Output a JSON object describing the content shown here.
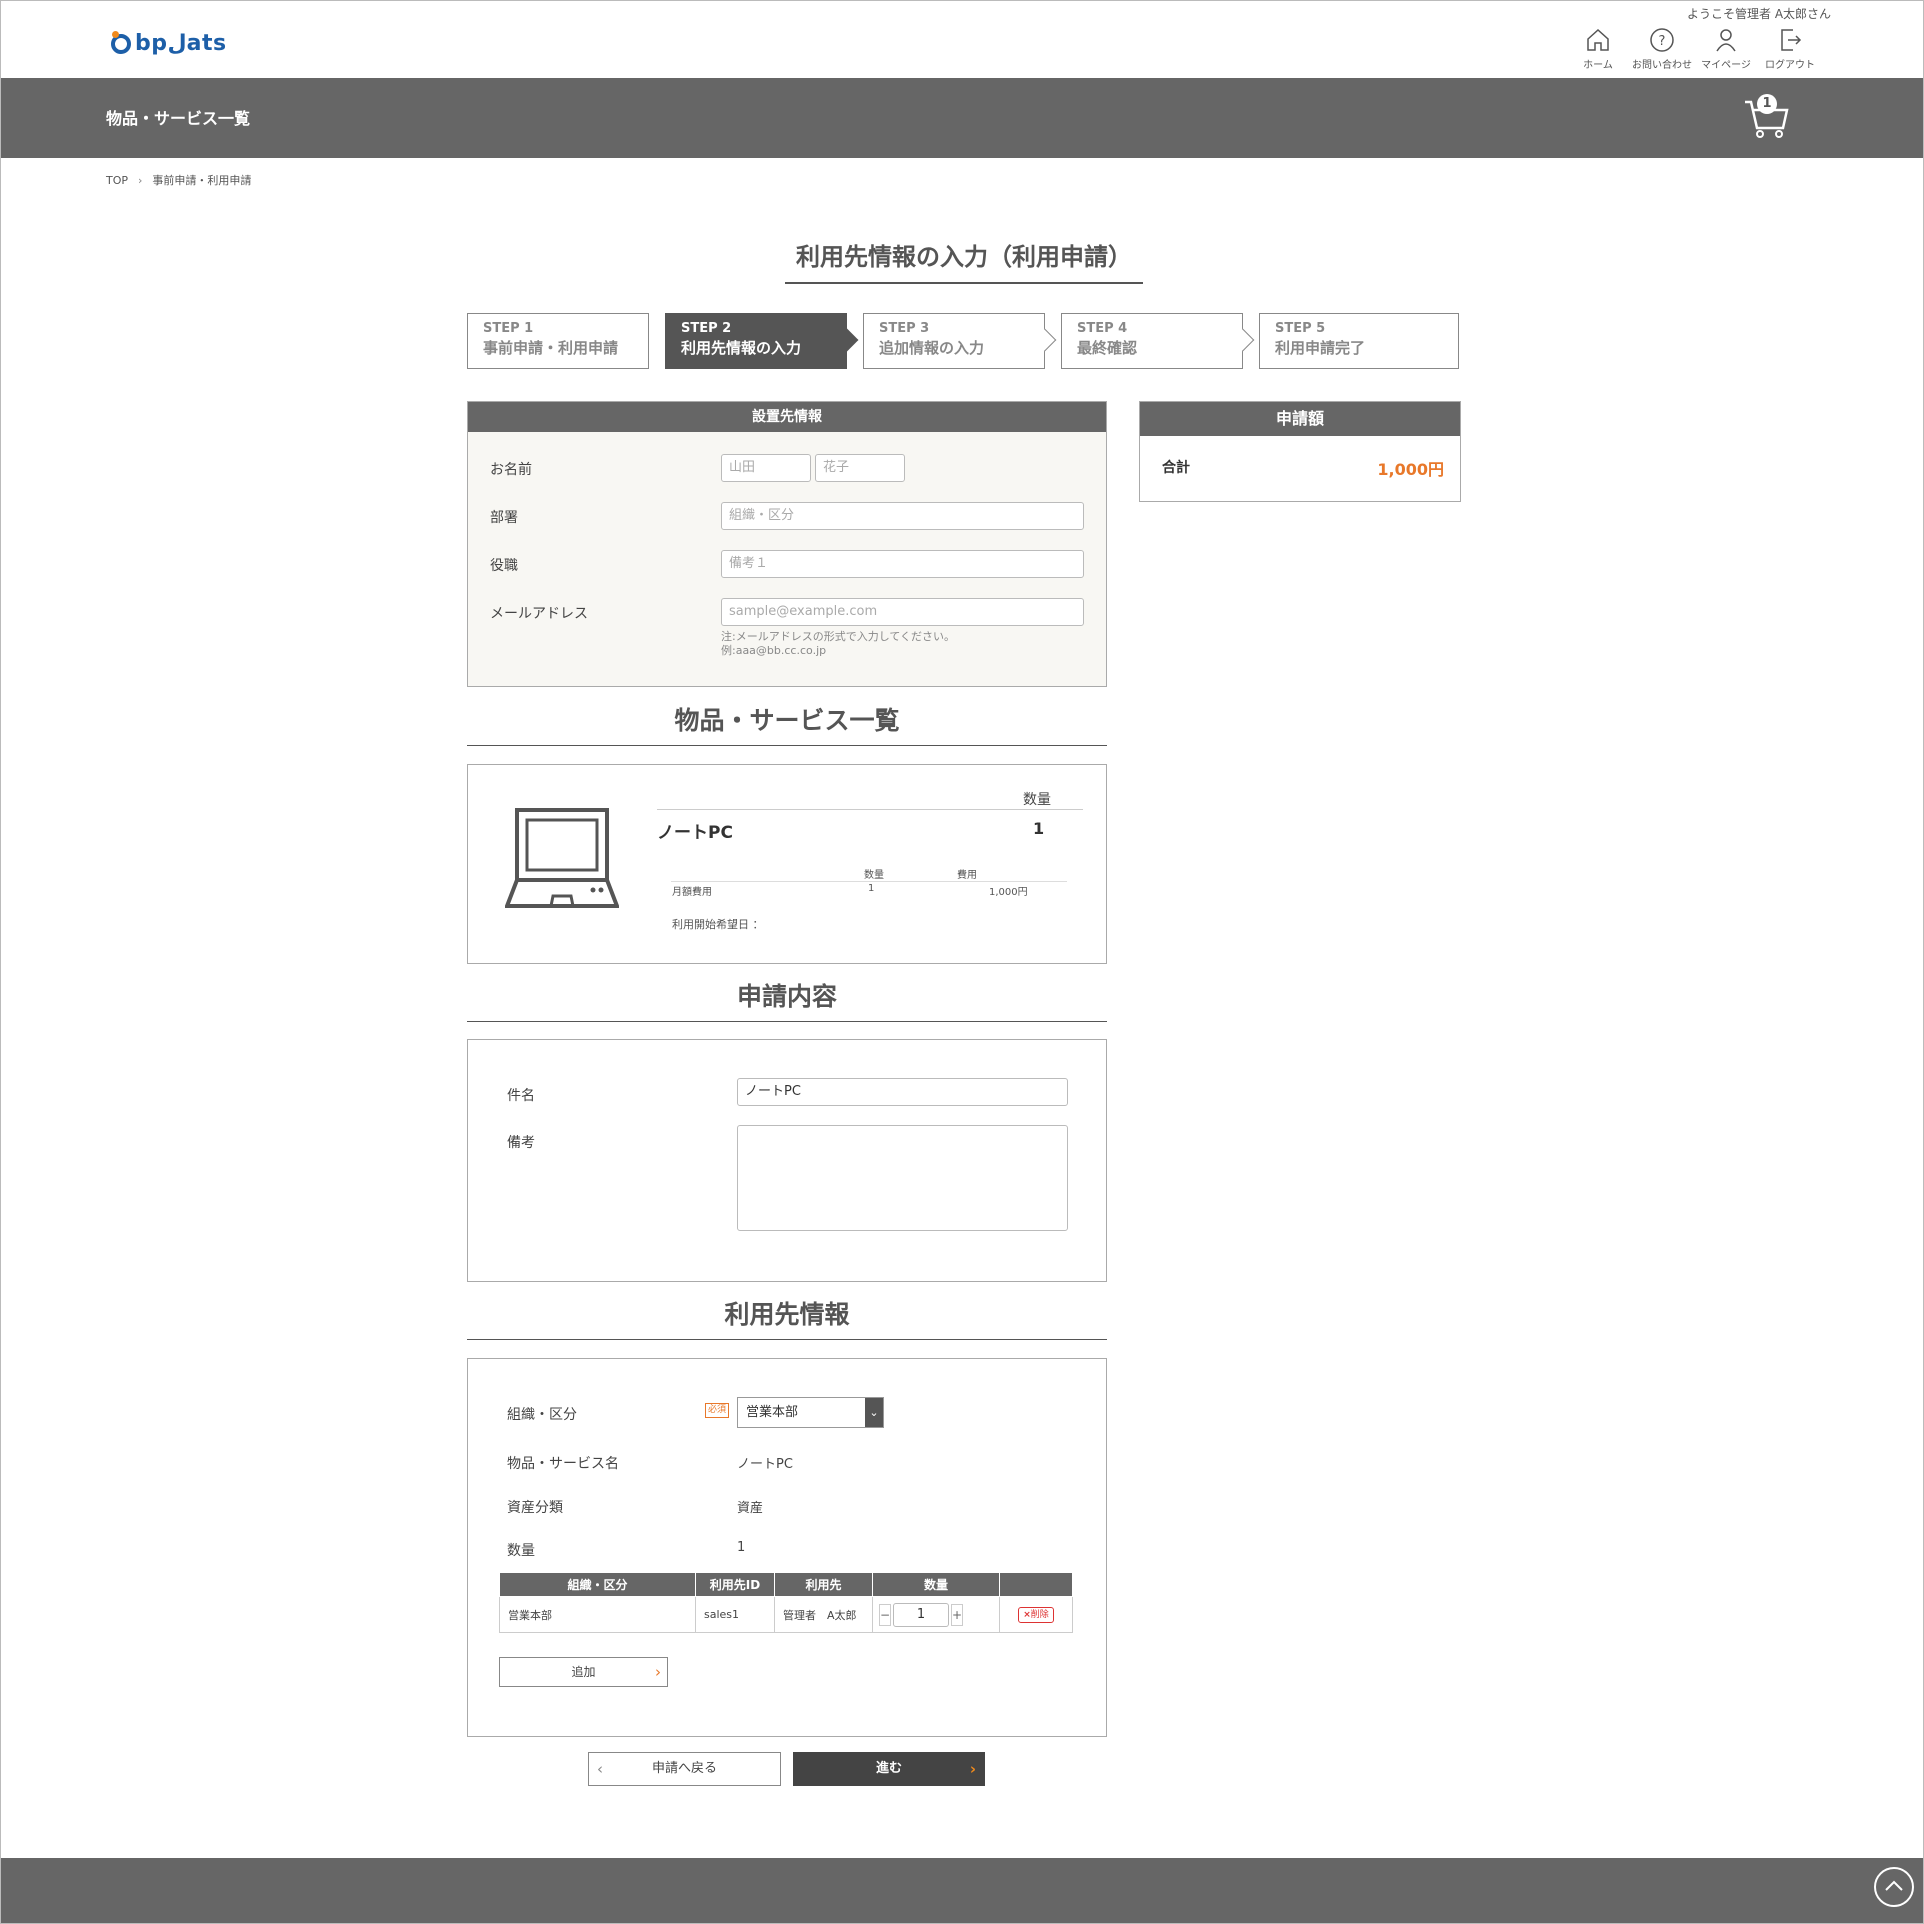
{
  "header": {
    "logo_text": "bpلats",
    "welcome": "ようこそ管理者 A太郎さん",
    "nav": [
      {
        "label": "ホーム",
        "icon": "home-icon"
      },
      {
        "label": "お問い合わせ",
        "icon": "help-icon"
      },
      {
        "label": "マイページ",
        "icon": "user-icon"
      },
      {
        "label": "ログアウト",
        "icon": "logout-icon"
      }
    ]
  },
  "titlebar": {
    "title": "物品・サービス一覧",
    "cart_count": "1"
  },
  "breadcrumb": {
    "top": "TOP",
    "current": "事前申請・利用申請"
  },
  "page_title": "利用先情報の入力（利用申請）",
  "steps": [
    {
      "num": "STEP 1",
      "label": "事前申請・利用申請"
    },
    {
      "num": "STEP 2",
      "label": "利用先情報の入力"
    },
    {
      "num": "STEP 3",
      "label": "追加情報の入力"
    },
    {
      "num": "STEP 4",
      "label": "最終確認"
    },
    {
      "num": "STEP 5",
      "label": "利用申請完了"
    }
  ],
  "install_info": {
    "heading": "設置先情報",
    "name_label": "お名前",
    "last_name_placeholder": "山田",
    "first_name_placeholder": "花子",
    "dept_label": "部署",
    "dept_placeholder": "組織・区分",
    "title_label": "役職",
    "title_placeholder": "備考１",
    "email_label": "メールアドレス",
    "email_placeholder": "sample@example.com",
    "email_note1": "注:メールアドレスの形式で入力してください。",
    "email_note2": "例:aaa@bb.cc.co.jp"
  },
  "summary": {
    "heading": "申請額",
    "total_label": "合計",
    "total_value": "1,000円",
    "accent": "#e8782a"
  },
  "products": {
    "heading": "物品・サービス一覧",
    "qty_header": "数量",
    "item_name": "ノートPC",
    "item_qty": "1",
    "sub_headers": {
      "qty": "数量",
      "cost": "費用"
    },
    "sub_row": {
      "label": "月額費用",
      "qty": "1",
      "cost": "1,000円"
    },
    "start_date_label": "利用開始希望日 ："
  },
  "request": {
    "heading": "申請内容",
    "subject_label": "件名",
    "subject_value": "ノートPC",
    "remarks_label": "備考"
  },
  "user_info": {
    "heading": "利用先情報",
    "org_label": "組織・区分",
    "required": "必須",
    "org_selected": "営業本部",
    "product_label": "物品・サービス名",
    "product_value": "ノートPC",
    "asset_label": "資産分類",
    "asset_value": "資産",
    "qty_label": "数量",
    "qty_value": "1",
    "table_headers": [
      "組織・区分",
      "利用先ID",
      "利用先",
      "数量",
      ""
    ],
    "table_row": {
      "org": "営業本部",
      "id": "sales1",
      "user": "管理者　A太郎",
      "qty": "1",
      "delete": "削除"
    },
    "add_button": "追加"
  },
  "actions": {
    "back": "申請へ戻る",
    "next": "進む"
  }
}
